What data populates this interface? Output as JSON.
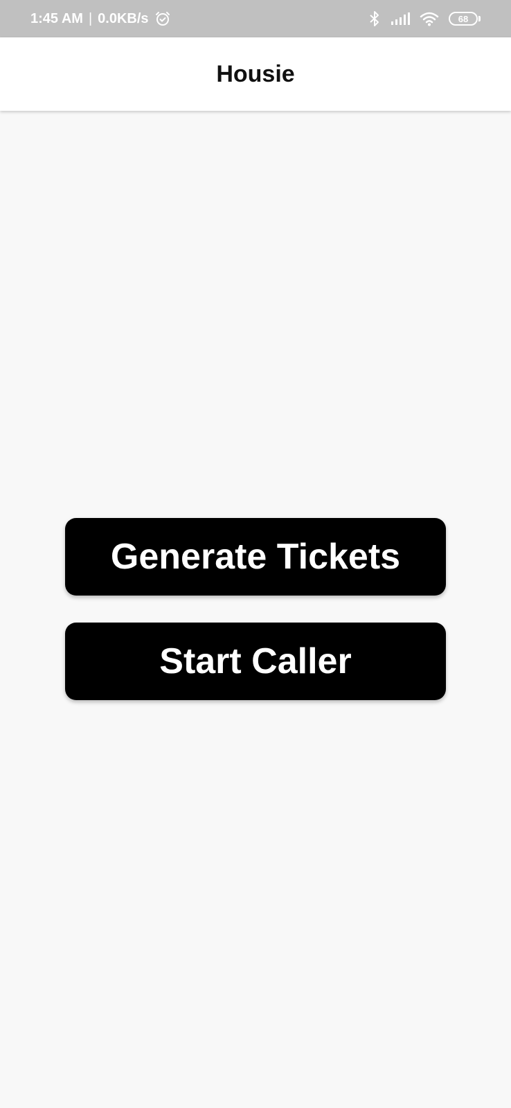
{
  "status_bar": {
    "time": "1:45 AM",
    "separator": "|",
    "network_speed": "0.0KB/s",
    "battery_level": "68",
    "icons": [
      "alarm-icon",
      "bluetooth-icon",
      "signal-icon",
      "wifi-icon",
      "battery-icon"
    ]
  },
  "app_bar": {
    "title": "Housie"
  },
  "actions": {
    "generate_label": "Generate Tickets",
    "caller_label": "Start Caller"
  },
  "colors": {
    "status_bar_bg": "#c0c0c0",
    "app_bar_bg": "#ffffff",
    "page_bg": "#f8f8f8",
    "button_bg": "#000000",
    "button_text": "#ffffff"
  }
}
